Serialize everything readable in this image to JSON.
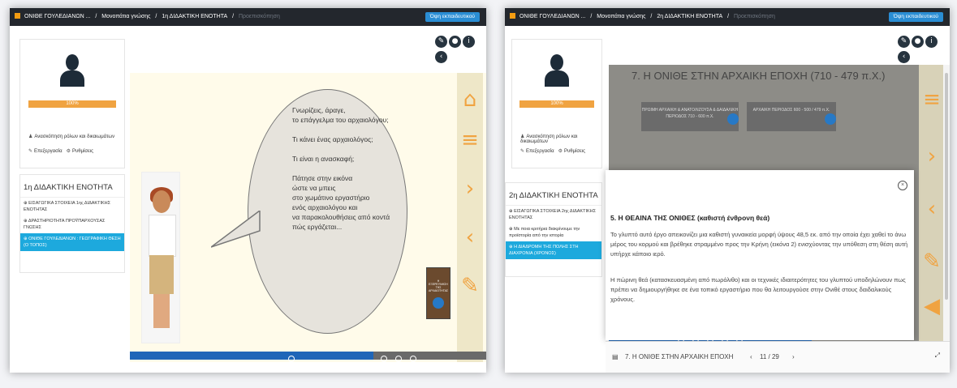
{
  "left": {
    "breadcrumb": [
      "ΟΝΙΘΕ ΓΟΥΛΕΔΙΑΝΩΝ ...",
      "/",
      "Μονοπάτια γνώσης",
      "/",
      "1η ΔΙΔΑΚΤΙΚΗ ΕΝΟΤΗΤΑ",
      "/",
      "Προεπισκόπηση"
    ],
    "view_button": "Όψη εκπαιδευτικού",
    "progress": "100%",
    "link_roles": "Ανασκόπηση ρόλων και δικαιωμάτων",
    "link_edit": "Επεξεργασία",
    "link_settings": "Ρυθμίσεις",
    "unit_title": "1η ΔΙΔΑΚΤΙΚΗ ΕΝΟΤΗΤΑ",
    "unit_items": [
      "ΕΙΣΑΓΩΓΙΚΑ ΣΤΟΙΧΕΙΑ 1ης ΔΙΔΑΚΤΙΚΗΣ ΕΝΟΤΗΤΑΣ",
      "ΔΡΑΣΤΗΡΙΟΤΗΤΑ ΠΡΟΫΠΑΡΧΟΥΣΑΣ ΓΝΩΣΗΣ",
      "ΟΝΙΘΕ ΓΟΥΛΕΔΙΑΝΩΝ : ΓΕΩΓΡΑΦΙΚΗ ΘΕΣΗ (Ο ΤΟΠΟΣ)"
    ],
    "speech_lines": [
      "Γνωρίζεις, άραγε,",
      "το επάγγελμα του αρχαιολόγου;",
      "",
      "Τι κάνει ένας αρχαιολόγος;",
      "",
      "Τι είναι η ανασκαφή;",
      "",
      "Πάτησε στην εικόνα",
      "ώστε να μπεις",
      "στο χωμάτινο εργαστήριο",
      "ενός αρχαιολόγου και",
      "να παρακολουθήσεις από κοντά",
      "πώς εργάζεται..."
    ],
    "book_title": "Η ΕΞΕΡΕΥΝΗΣΗ ΤΗΣ ΑΡΧΑΙΟΤΗΤΑΣ"
  },
  "right": {
    "breadcrumb": [
      "ΟΝΙΘΕ ΓΟΥΛΕΔΙΑΝΩΝ ...",
      "/",
      "Μονοπάτια γνώσης",
      "/",
      "2η ΔΙΔΑΚΤΙΚΗ ΕΝΟΤΗΤΑ",
      "/",
      "Προεπισκόπηση"
    ],
    "view_button": "Όψη εκπαιδευτικού",
    "progress": "100%",
    "link_roles": "Ανασκόπηση ρόλων και δικαιωμάτων",
    "link_edit": "Επεξεργασία",
    "link_settings": "Ρυθμίσεις",
    "unit_title": "2η ΔΙΔΑΚΤΙΚΗ ΕΝΟΤΗΤΑ",
    "unit_items": [
      "ΕΙΣΑΓΩΓΙΚΑ ΣΤΟΙΧΕΙΑ 2ης ΔΙΔΑΚΤΙΚΗΣ ΕΝΟΤΗΤΑΣ",
      "Με ποια κριτήρια διακρίνουμε την προϊστορία από την ιστορία",
      "Η ΔΙΑΔΡΟΜΗ ΤΗΣ ΠΟΛΗΣ ΣΤΗ ΔΙΑΧΡΟΝΙΑ (ΧΡΟΝΟΣ)"
    ],
    "slide_heading": "7. Η ΟΝΙΘΕ ΣΤΗΝ ΑΡΧΑΙΚΗ ΕΠΟΧΗ (710 - 479 π.Χ.)",
    "period1": "ΠΡΩΙΜΗ ΑΡΧΑΙΚΗ & ΑΝΑΤΟΛΙΖΟΥΣΑ & ΔΑΙΔΑΛΙΚΗ ΠΕΡΙΟΔΟΣ 710 - 600 π.Χ.",
    "period2": "ΑΡΧΑΙΚΗ ΠΕΡΙΟΔΟΣ 600 - 500 / 479 π.Χ.",
    "dialog_title": "5. Η ΘΕΑΙΝΑ ΤΗΣ ΟΝΙΘΕΣ (καθιστή ένθρονη θεά)",
    "dialog_p1": "Το γλυπτό αυτό έργο απεικονίζει μια καθιστή γυναικεία μορφή ύψους 48,5 εκ. από την οποία έχει χαθεί το άνω μέρος του κορμού και βρέθηκε στραμμένο προς την Κρήνη (εικόνα 2) ενισχύοντας την υπόθεση στη θέση αυτή υπήρχε κάποιο ιερό.",
    "dialog_p2": "Η πώρινη θεά (κατασκευασμένη από πωρόλιθο) και οι τεχνικές ιδιαιτερότητες του γλυπτού υποδηλώνουν πως πρέπει να δημιουργήθηκε σε ένα τοπικό εργαστήριο που θα λειτουργούσε στην Ονιθέ στους δαιδαλικούς χρόνους.",
    "footer_title": "7. Η ΟΝΙΘΕ ΣΤΗΝ ΑΡΧΑΙΚΗ ΕΠΟΧΗ",
    "page": "11 / 29"
  },
  "colors": {
    "topbar": "#23272d",
    "accent": "#f0a341",
    "active": "#1da9dd",
    "nav_blue": "#1f66b8"
  },
  "icons": [
    "home-icon",
    "menu-icon",
    "chevron-right-icon",
    "chevron-left-icon",
    "notebook-icon",
    "speaker-icon",
    "link-icon",
    "close-icon",
    "expand-icon"
  ]
}
